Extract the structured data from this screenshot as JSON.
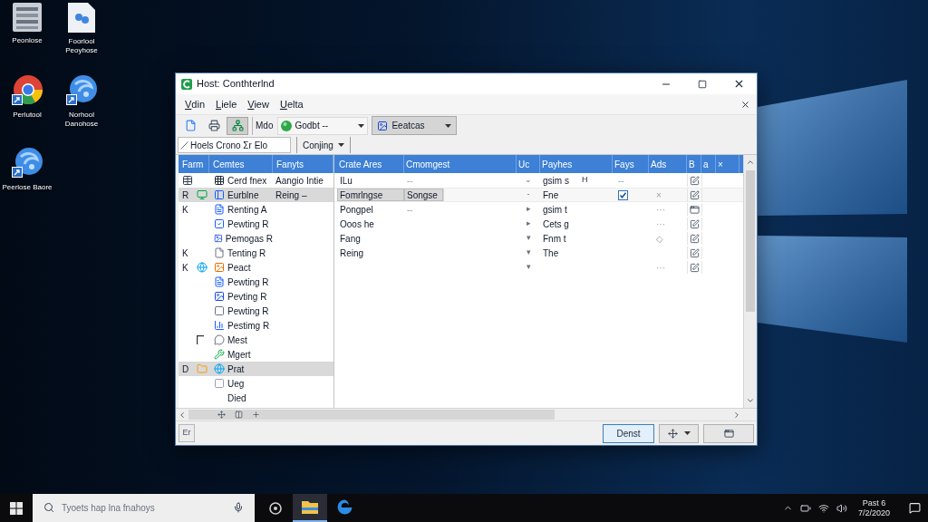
{
  "desktop": {
    "icons": [
      {
        "kind": "list",
        "label": "Peonlose"
      },
      {
        "kind": "ring",
        "label": "Perlutool"
      },
      {
        "kind": "globe",
        "label": "Peerlose Baore"
      },
      {
        "kind": "document",
        "label": "Foorlool Peoyhose"
      },
      {
        "kind": "globe",
        "label": "Norhool Danohose"
      }
    ]
  },
  "window": {
    "title": "Host: Conthterlnd",
    "menu": [
      "Vdin",
      "Liele",
      "View",
      "Uelta"
    ],
    "toolbar": {
      "buttons": [
        {
          "kind": "document",
          "pressed": false
        },
        {
          "kind": "printer",
          "pressed": false
        },
        {
          "kind": "network",
          "pressed": true
        }
      ],
      "label": "Mdo",
      "combo": "Godbt --",
      "dropdown": "Eeatcas"
    },
    "filter": {
      "value": "Hoels Crono Σr Elo",
      "dropdown": "Conjing"
    },
    "tree": {
      "columns": [
        "Farm",
        "Cemtes",
        "Fanyts"
      ],
      "rows": [
        {
          "selected": false,
          "name": "Cerd fnex",
          "value": "Aangio Intie"
        },
        {
          "selected": true,
          "lead": "R",
          "name": "Eurblne",
          "value": "Reing –"
        },
        {
          "selected": false,
          "lead": "K",
          "name": "Renting A"
        },
        {
          "selected": false,
          "name": "Pewting R"
        },
        {
          "selected": false,
          "name": "Pemogas R"
        },
        {
          "selected": false,
          "lead": "K",
          "name": "Tenting R"
        },
        {
          "selected": false,
          "lead": "K",
          "name": "Peact"
        },
        {
          "selected": false,
          "name": "Pewting R"
        },
        {
          "selected": false,
          "name": "Pevting R"
        },
        {
          "selected": false,
          "name": "Pewting R"
        },
        {
          "selected": false,
          "name": "Pestimg R"
        },
        {
          "selected": false,
          "name": "Mest"
        },
        {
          "selected": false,
          "name": "Mgert"
        },
        {
          "selected": true,
          "lead": "D",
          "name": "Prat"
        },
        {
          "selected": false,
          "name": "Ueg"
        },
        {
          "selected": false,
          "name": "Died"
        }
      ]
    },
    "table": {
      "columns": [
        "Crate Ares",
        "Cmomgest",
        "Uc",
        "Payhes",
        "Fays",
        "Ads",
        "B",
        "a",
        "×"
      ],
      "rows": [
        {
          "selected": false,
          "name": "ILu",
          "category": "--",
          "arrow": "⌄",
          "payload": "gsim s",
          "payload_mark": "H",
          "fays": {
            "kind": "text",
            "text": "--"
          }
        },
        {
          "selected": true,
          "name": "Fomrlngse",
          "category": "Songse",
          "arrow": "-",
          "payload": "Fne",
          "fays": {
            "kind": "check",
            "checked": true
          },
          "ads": "×"
        },
        {
          "selected": false,
          "name": "Pongpel",
          "category": "--",
          "arrow": "▸",
          "payload": "gsim t",
          "ads": "···"
        },
        {
          "selected": false,
          "name": "Ooos he",
          "arrow": "▸",
          "payload": "Cets g",
          "ads": "···"
        },
        {
          "selected": false,
          "name": "Fang",
          "arrow": "▾",
          "payload": "Fnm t",
          "ads": "◇"
        },
        {
          "selected": false,
          "name": "Reing",
          "arrow": "▾",
          "payload": "The"
        },
        {
          "selected": false,
          "arrow": "▾",
          "ads": "···"
        }
      ]
    },
    "status_bar": {
      "button": "Er",
      "actions": [
        {
          "kind": "text",
          "label": "Denst",
          "default": true
        },
        {
          "kind": "menu",
          "default": false
        },
        {
          "kind": "window",
          "default": false
        }
      ]
    }
  },
  "taskbar": {
    "search": {
      "placeholder": "Tyoets hap lna fnahoys"
    },
    "apps": [
      {
        "kind": "folder",
        "active": true
      },
      {
        "kind": "swirl",
        "active": false
      }
    ],
    "clock": {
      "time": "Past 6",
      "date": "7/2/2020"
    }
  }
}
